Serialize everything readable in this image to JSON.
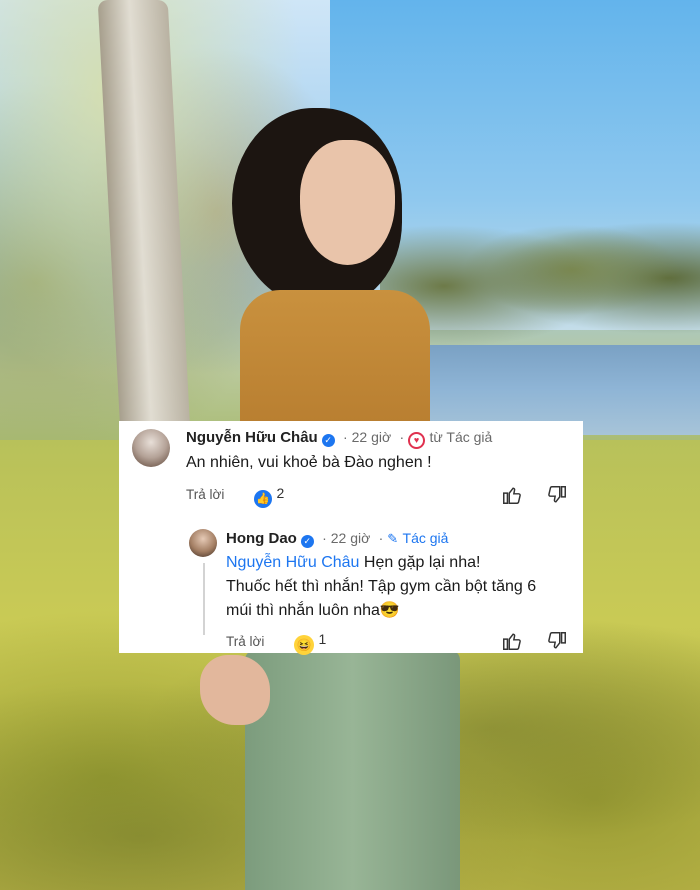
{
  "comments": [
    {
      "author": "Nguyễn Hữu Châu",
      "verified": true,
      "time": "22 giờ",
      "author_badge": "từ Tác giả",
      "text": "An nhiên, vui khoẻ bà Đào nghen !",
      "reply_label": "Trả lời",
      "reaction": {
        "icon": "like-icon",
        "count": "2"
      }
    },
    {
      "author": "Hong Dao",
      "verified": true,
      "time": "22 giờ",
      "author_badge": "Tác giả",
      "mention": "Nguyễn Hữu Châu",
      "text_line1": " Hẹn gặp lại nha!",
      "text_line2": "Thuốc hết thì nhắn! Tập gym cần bột tăng 6",
      "text_line3": "múi thì nhắn luôn nha😎",
      "reply_label": "Trả lời",
      "reaction": {
        "icon": "laugh-emoji-icon",
        "count": "1"
      }
    }
  ],
  "colors": {
    "accent": "#1d76f0",
    "heart": "#e0314f"
  }
}
